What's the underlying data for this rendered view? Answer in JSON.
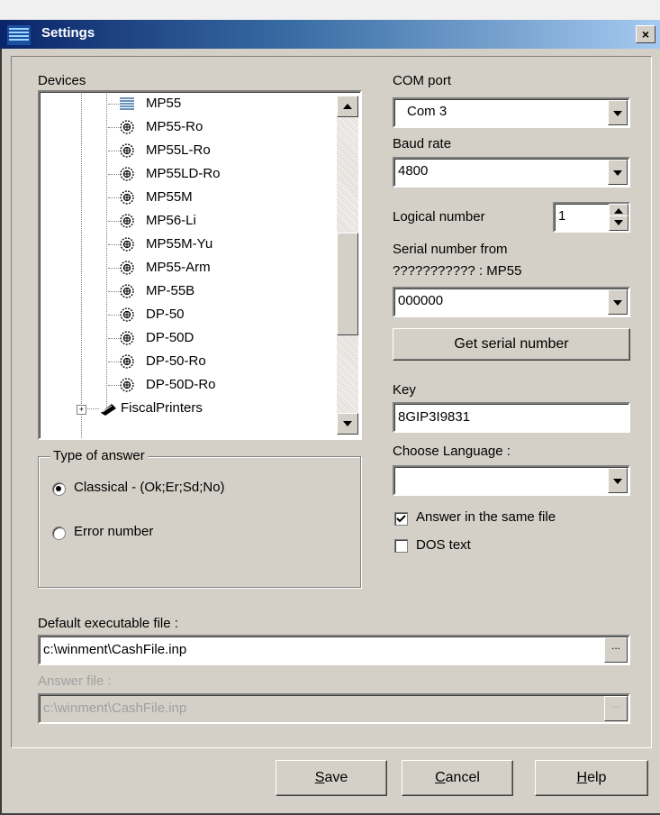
{
  "window": {
    "title": "Settings",
    "close_label": "×"
  },
  "devices": {
    "label": "Devices",
    "items": [
      {
        "label": "MP55",
        "icon": "serial-port-icon"
      },
      {
        "label": "MP55-Ro",
        "icon": "device-gear-icon"
      },
      {
        "label": "MP55L-Ro",
        "icon": "device-gear-icon"
      },
      {
        "label": "MP55LD-Ro",
        "icon": "device-gear-icon"
      },
      {
        "label": "MP55M",
        "icon": "device-gear-icon"
      },
      {
        "label": "MP56-Li",
        "icon": "device-gear-icon"
      },
      {
        "label": "MP55M-Yu",
        "icon": "device-gear-icon"
      },
      {
        "label": "MP55-Arm",
        "icon": "device-gear-icon"
      },
      {
        "label": "MP-55B",
        "icon": "device-gear-icon"
      },
      {
        "label": "DP-50",
        "icon": "device-gear-icon"
      },
      {
        "label": "DP-50D",
        "icon": "device-gear-icon"
      },
      {
        "label": "DP-50-Ro",
        "icon": "device-gear-icon"
      },
      {
        "label": "DP-50D-Ro",
        "icon": "device-gear-icon"
      },
      {
        "label": "FiscalPrinters",
        "icon": "printer-folder-icon"
      }
    ]
  },
  "answer_type": {
    "label": "Type of answer",
    "option_classical": "Classical - (Ok;Er;Sd;No)",
    "option_error": "Error number",
    "selected": "classical"
  },
  "com_port": {
    "label": "COM port",
    "value": "Com 3"
  },
  "baud_rate": {
    "label": "Baud rate",
    "value": "4800"
  },
  "logical_number": {
    "label": "Logical number",
    "value": "1"
  },
  "serial": {
    "label_line1": "Serial number from",
    "label_line2": "??????????? : MP55",
    "value": "000000",
    "get_button": "Get serial number"
  },
  "key": {
    "label": "Key",
    "value": "8GIP3I9831"
  },
  "language": {
    "label": "Choose Language :",
    "value": ""
  },
  "answer_same_file": {
    "label": "Answer in the same file",
    "checked": true
  },
  "dos_text": {
    "label": "DOS text",
    "checked": false
  },
  "default_exe": {
    "label": "Default executable file :",
    "value": "c:\\winment\\CashFile.inp",
    "browse": "..."
  },
  "answer_file": {
    "label": "Answer file :",
    "value": "c:\\winment\\CashFile.inp",
    "browse": "..."
  },
  "buttons": {
    "save_mnemonic": "S",
    "save_rest": "ave",
    "cancel_mnemonic": "C",
    "cancel_rest": "ancel",
    "help_mnemonic": "H",
    "help_rest": "elp"
  },
  "colors": {
    "titlebar_start": "#0a246a",
    "titlebar_end": "#a6caf0",
    "dialog_bg": "#d4d0c8"
  }
}
